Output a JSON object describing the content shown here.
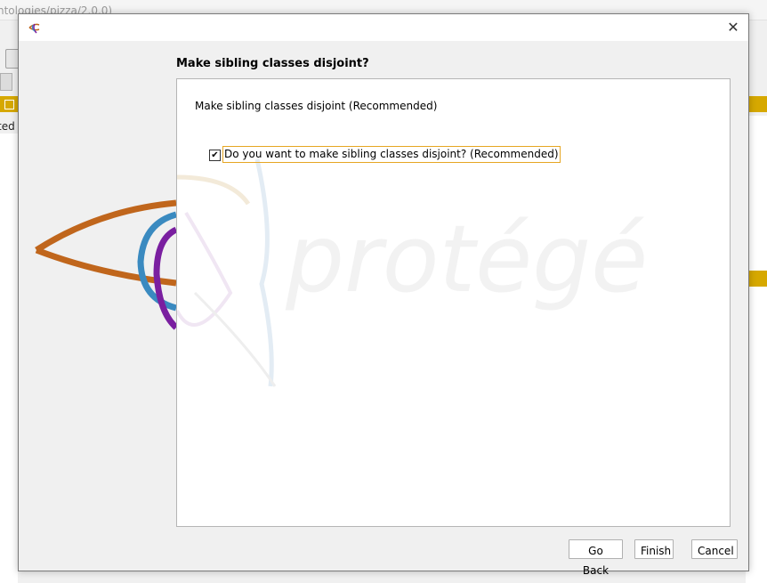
{
  "background": {
    "window_title": "ntologies/pizza/2.0.0)",
    "partial_text": "ted"
  },
  "dialog": {
    "heading": "Make sibling classes disjoint?",
    "description": "Make sibling classes disjoint (Recommended)",
    "checkbox": {
      "label": "Do you want to make sibling classes disjoint? (Recommended)",
      "checked": true,
      "check_glyph": "✔"
    },
    "close_glyph": "✕",
    "watermark_text": "protégé",
    "buttons": {
      "back": "Go Back",
      "finish": "Finish",
      "cancel": "Cancel"
    }
  },
  "colors": {
    "protege_orange": "#c0661c",
    "protege_blue": "#3a8ac0",
    "protege_purple": "#7a1fa0",
    "focus_border": "#e6a623",
    "accent_yellow": "#d6a800"
  },
  "icons": {
    "app": "protege-logo-icon",
    "close": "close-icon",
    "check": "checkmark-icon"
  }
}
